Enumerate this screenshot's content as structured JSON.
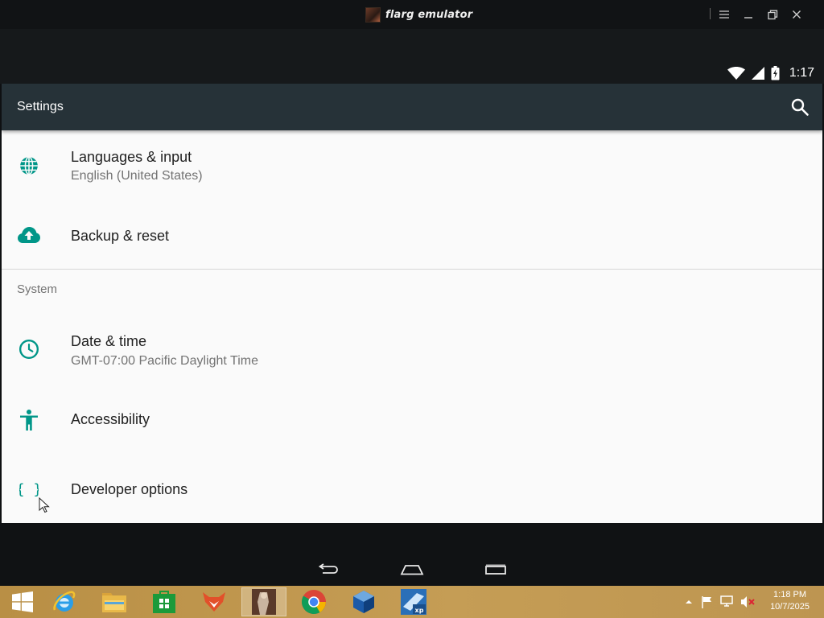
{
  "window": {
    "title": "flarg emulator",
    "controls": {
      "menu": "menu-icon",
      "minimize": "minimize-icon",
      "restore": "restore-icon",
      "close": "close-icon"
    }
  },
  "statusbar": {
    "time": "1:17",
    "icons": [
      "wifi-icon",
      "cell-signal-icon",
      "battery-charging-icon"
    ]
  },
  "appbar": {
    "title": "Settings",
    "search_icon": "search-icon"
  },
  "settings": {
    "items": [
      {
        "title": "Languages & input",
        "subtitle": "English (United States)",
        "icon": "globe-icon"
      },
      {
        "title": "Backup & reset",
        "icon": "cloud-upload-icon"
      }
    ],
    "section_header": "System",
    "system_items": [
      {
        "title": "Date & time",
        "subtitle": "GMT-07:00 Pacific Daylight Time",
        "icon": "clock-icon"
      },
      {
        "title": "Accessibility",
        "icon": "accessibility-icon"
      },
      {
        "title": "Developer options",
        "icon": "braces-icon"
      }
    ]
  },
  "navbar": {
    "back": "back-icon",
    "home": "home-icon",
    "recents": "recents-icon"
  },
  "taskbar": {
    "apps": [
      "windows-start-icon",
      "internet-explorer-icon",
      "file-explorer-icon",
      "store-icon",
      "fox-app-icon",
      "flarg-emulator-icon",
      "chrome-icon",
      "virtualbox-icon",
      "xp-mode-icon"
    ],
    "active_app": "flarg-emulator-icon",
    "tray_icons": [
      "show-hidden-icon",
      "action-center-flag-icon",
      "network-icon",
      "volume-muted-icon"
    ],
    "clock_time": "1:18 PM",
    "clock_date": "10/7/2025"
  },
  "colors": {
    "accent": "#009688",
    "appbar": "#263238",
    "taskbar": "#c09a52"
  }
}
